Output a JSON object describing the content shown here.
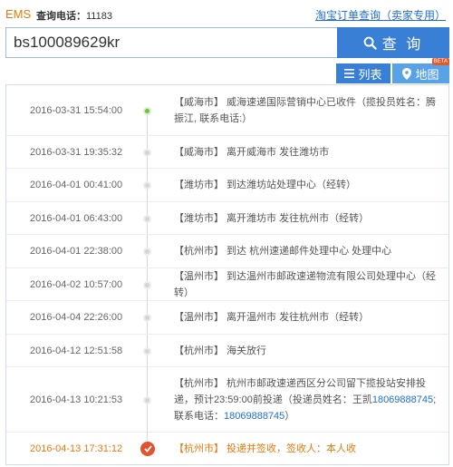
{
  "header": {
    "brand": "EMS",
    "phone_label": "查询电话：",
    "phone": "11183",
    "taobao_link": "淘宝订单查询（卖家专用）"
  },
  "search": {
    "value": "bs100089629kr",
    "button_label": "查 询"
  },
  "tabs": {
    "list_label": "列表",
    "map_label": "地图",
    "beta": "BETA"
  },
  "events": [
    {
      "time": "2016-03-31 15:54:00",
      "text": "【威海市】 威海速递国际营销中心已收件（揽投员姓名：腾振江, 联系电话:）"
    },
    {
      "time": "2016-03-31 19:35:32",
      "text": "【威海市】 离开威海市 发往潍坊市"
    },
    {
      "time": "2016-04-01 00:41:00",
      "text": "【潍坊市】 到达潍坊站处理中心（经转）"
    },
    {
      "time": "2016-04-01 06:43:00",
      "text": "【潍坊市】 离开潍坊市 发往杭州市（经转）"
    },
    {
      "time": "2016-04-01 22:38:00",
      "text": "【杭州市】 到达 杭州速递邮件处理中心 处理中心"
    },
    {
      "time": "2016-04-02 10:57:00",
      "text": "【温州市】 到达温州市邮政速递物流有限公司处理中心（经转）"
    },
    {
      "time": "2016-04-04 22:26:00",
      "text": "【温州市】 离开温州市 发往杭州市（经转）"
    },
    {
      "time": "2016-04-12 12:51:58",
      "text": "【杭州市】 海关放行"
    },
    {
      "time": "2016-04-13 10:21:53",
      "text_a": "【杭州市】 杭州市邮政速递西区分公司留下揽投站安排投递，预计23:59:00前投递（投递员姓名：王凯",
      "phone_a": "18069888745",
      "text_b": ";联系电话：",
      "phone_b": "18069888745",
      "text_c": "）"
    },
    {
      "time": "2016-04-13 17:31:12",
      "text": "【杭州市】 投递并签收，签收人：本人收"
    }
  ],
  "colors": {
    "accent": "#3a7fd6",
    "brand": "#e8790c",
    "start_dot": "#6dc23f",
    "final_dot": "#e2532f"
  }
}
